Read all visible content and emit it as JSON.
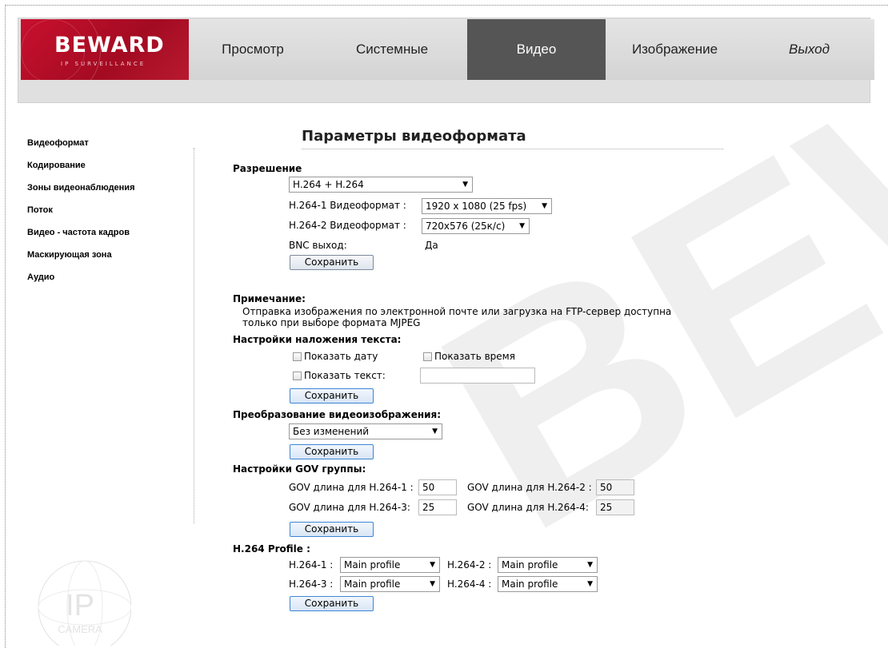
{
  "logo": {
    "brand": "BEWARD",
    "sub": "IP SURVEILLANCE"
  },
  "nav": {
    "items": [
      {
        "label": "Просмотр"
      },
      {
        "label": "Системные"
      },
      {
        "label": "Видео"
      },
      {
        "label": "Изображение"
      },
      {
        "label": "Выход"
      }
    ]
  },
  "sidebar": {
    "items": [
      {
        "label": "Видеоформат"
      },
      {
        "label": "Кодирование"
      },
      {
        "label": "Зоны видеонаблюдения"
      },
      {
        "label": "Поток"
      },
      {
        "label": "Видео - частота кадров"
      },
      {
        "label": "Маскирующая зона"
      },
      {
        "label": "Аудио"
      }
    ]
  },
  "page": {
    "title": "Параметры видеоформата"
  },
  "resolution": {
    "heading": "Разрешение",
    "mode": "H.264 + H.264",
    "fmt1_label": "H.264-1 Видеоформат :",
    "fmt1_value": "1920 x 1080 (25 fps)",
    "fmt2_label": "H.264-2 Видеоформат :",
    "fmt2_value": "720x576 (25к/с)",
    "bnc_label": "BNC выход:",
    "bnc_value": "Да",
    "save": "Сохранить"
  },
  "note": {
    "heading": "Примечание:",
    "line1": "Отправка изображения по электронной почте или загрузка на FTP-сервер доступна",
    "line2": "только при выборе формата MJPEG"
  },
  "overlay": {
    "heading": "Настройки наложения текста:",
    "show_date": "Показать дату",
    "show_time": "Показать время",
    "show_text": "Показать текст:",
    "text_value": "",
    "save": "Сохранить"
  },
  "transform": {
    "heading": "Преобразование видеоизображения:",
    "value": "Без изменений",
    "save": "Сохранить"
  },
  "gov": {
    "heading": "Настройки GOV группы:",
    "l1": "GOV длина для H.264-1 :",
    "v1": "50",
    "l2": "GOV длина для H.264-2 :",
    "v2": "50",
    "l3": "GOV длина для H.264-3:",
    "v3": "25",
    "l4": "GOV длина для H.264-4:",
    "v4": "25",
    "save": "Сохранить"
  },
  "profile": {
    "heading": "H.264 Profile :",
    "l1": "H.264-1 :",
    "v1": "Main profile",
    "l2": "H.264-2 :",
    "v2": "Main profile",
    "l3": "H.264-3 :",
    "v3": "Main profile",
    "l4": "H.264-4 :",
    "v4": "Main profile",
    "save": "Сохранить"
  },
  "camera_logo": {
    "line1": "IP",
    "line2": "CAMERA"
  },
  "watermark": {
    "text": "BEWARD"
  }
}
